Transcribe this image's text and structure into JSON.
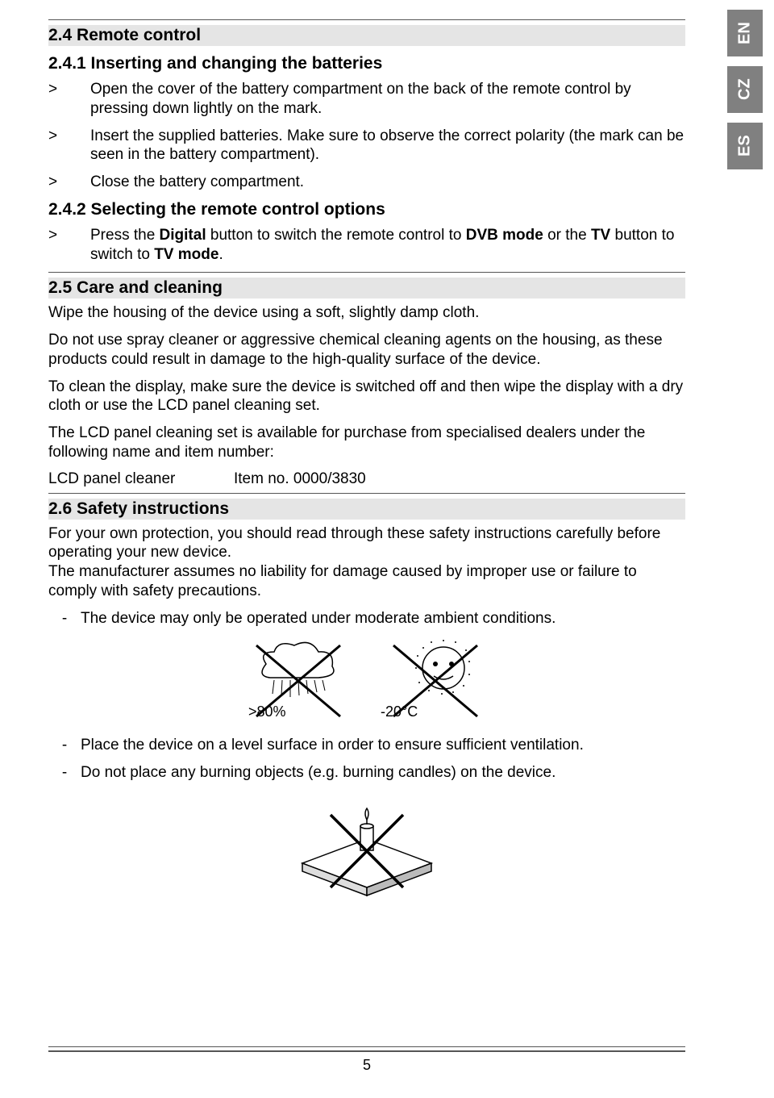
{
  "side_tabs": [
    "EN",
    "CZ",
    "ES"
  ],
  "s24": {
    "heading": "2.4 Remote control",
    "s241": {
      "heading": "2.4.1 Inserting and changing the batteries",
      "items": [
        {
          "marker": ">",
          "text": "Open the cover of the battery compartment on the back of the remote control by pressing down lightly on the mark."
        },
        {
          "marker": ">",
          "text": "Insert the supplied batteries. Make sure to observe the correct polarity (the mark can be seen in the battery compartment)."
        },
        {
          "marker": ">",
          "text": "Close the battery compartment."
        }
      ]
    },
    "s242": {
      "heading": "2.4.2 Selecting the remote control options",
      "item_marker": ">",
      "t1": "Press the ",
      "t2": "Digital",
      "t3": " button to switch the remote control to ",
      "t4": "DVB mode",
      "t5": " or the ",
      "t6": "TV",
      "t7": " button to switch to ",
      "t8": "TV mode",
      "t9": "."
    }
  },
  "s25": {
    "heading": "2.5 Care and cleaning",
    "p1": "Wipe the housing of the device using a soft, slightly damp cloth.",
    "p2": "Do not use spray cleaner or aggressive chemical cleaning agents on the housing, as these products could result in damage to the high-quality surface of the device.",
    "p3": "To clean the display, make sure the device is switched off and then wipe the display with a dry cloth or use the LCD panel cleaning set.",
    "p4": "The LCD panel cleaning set is available for purchase from specialised dealers under the following name and item number:",
    "item_label": "LCD panel cleaner",
    "item_no": "Item no. 0000/3830"
  },
  "s26": {
    "heading": "2.6 Safety instructions",
    "p1": "For your own protection, you should read through these safety instructions carefully before operating your new device.",
    "p2": "The manufacturer assumes no liability for damage caused by improper use or failure to comply with safety precautions.",
    "items": [
      {
        "marker": "-",
        "text": "The device may only be operated under moderate ambient conditions."
      },
      {
        "marker": "-",
        "text": "Place the device on a level surface in order to ensure sufficient ventilation."
      },
      {
        "marker": "-",
        "text": "Do not place any burning objects (e.g. burning candles) on the device."
      }
    ],
    "fig1_labels": {
      "left": ">80%",
      "right": "-20°C"
    }
  },
  "page_number": "5"
}
